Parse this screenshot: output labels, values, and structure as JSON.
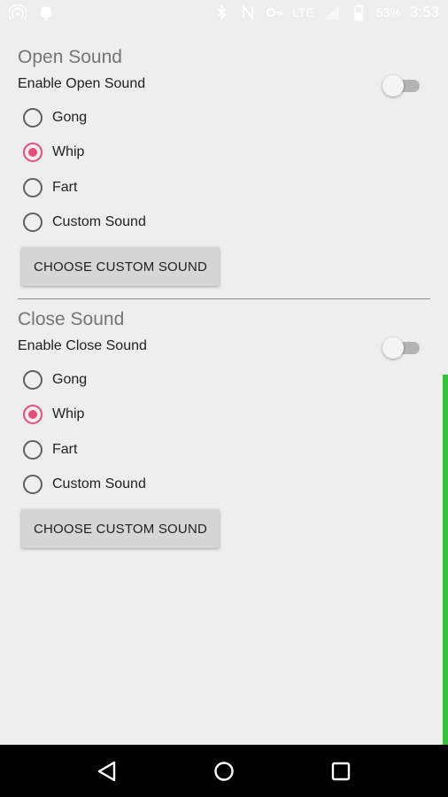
{
  "status_bar": {
    "battery_percent": "53%",
    "time": "3:53",
    "network_label": "LTE",
    "left_icons": [
      "wifi-hotspot-icon",
      "android-debug-icon"
    ],
    "right_icons": [
      "bluetooth-icon",
      "nfc-icon",
      "key-icon",
      "lte-icon",
      "signal-icon",
      "battery-icon"
    ]
  },
  "open_sound": {
    "title": "Open Sound",
    "enable_label": "Enable Open Sound",
    "enabled": false,
    "options": [
      {
        "label": "Gong",
        "checked": false
      },
      {
        "label": "Whip",
        "checked": true
      },
      {
        "label": "Fart",
        "checked": false
      },
      {
        "label": "Custom Sound",
        "checked": false
      }
    ],
    "button_label": "CHOOSE CUSTOM SOUND"
  },
  "close_sound": {
    "title": "Close Sound",
    "enable_label": "Enable Close Sound",
    "enabled": false,
    "options": [
      {
        "label": "Gong",
        "checked": false
      },
      {
        "label": "Whip",
        "checked": true
      },
      {
        "label": "Fart",
        "checked": false
      },
      {
        "label": "Custom Sound",
        "checked": false
      }
    ],
    "button_label": "CHOOSE CUSTOM SOUND"
  },
  "nav_bar": {
    "buttons": [
      "back-icon",
      "home-icon",
      "recents-icon"
    ]
  },
  "colors": {
    "accent": "#ea4c7a",
    "scroll_indicator": "#34c33a",
    "background": "#eeeeee"
  }
}
